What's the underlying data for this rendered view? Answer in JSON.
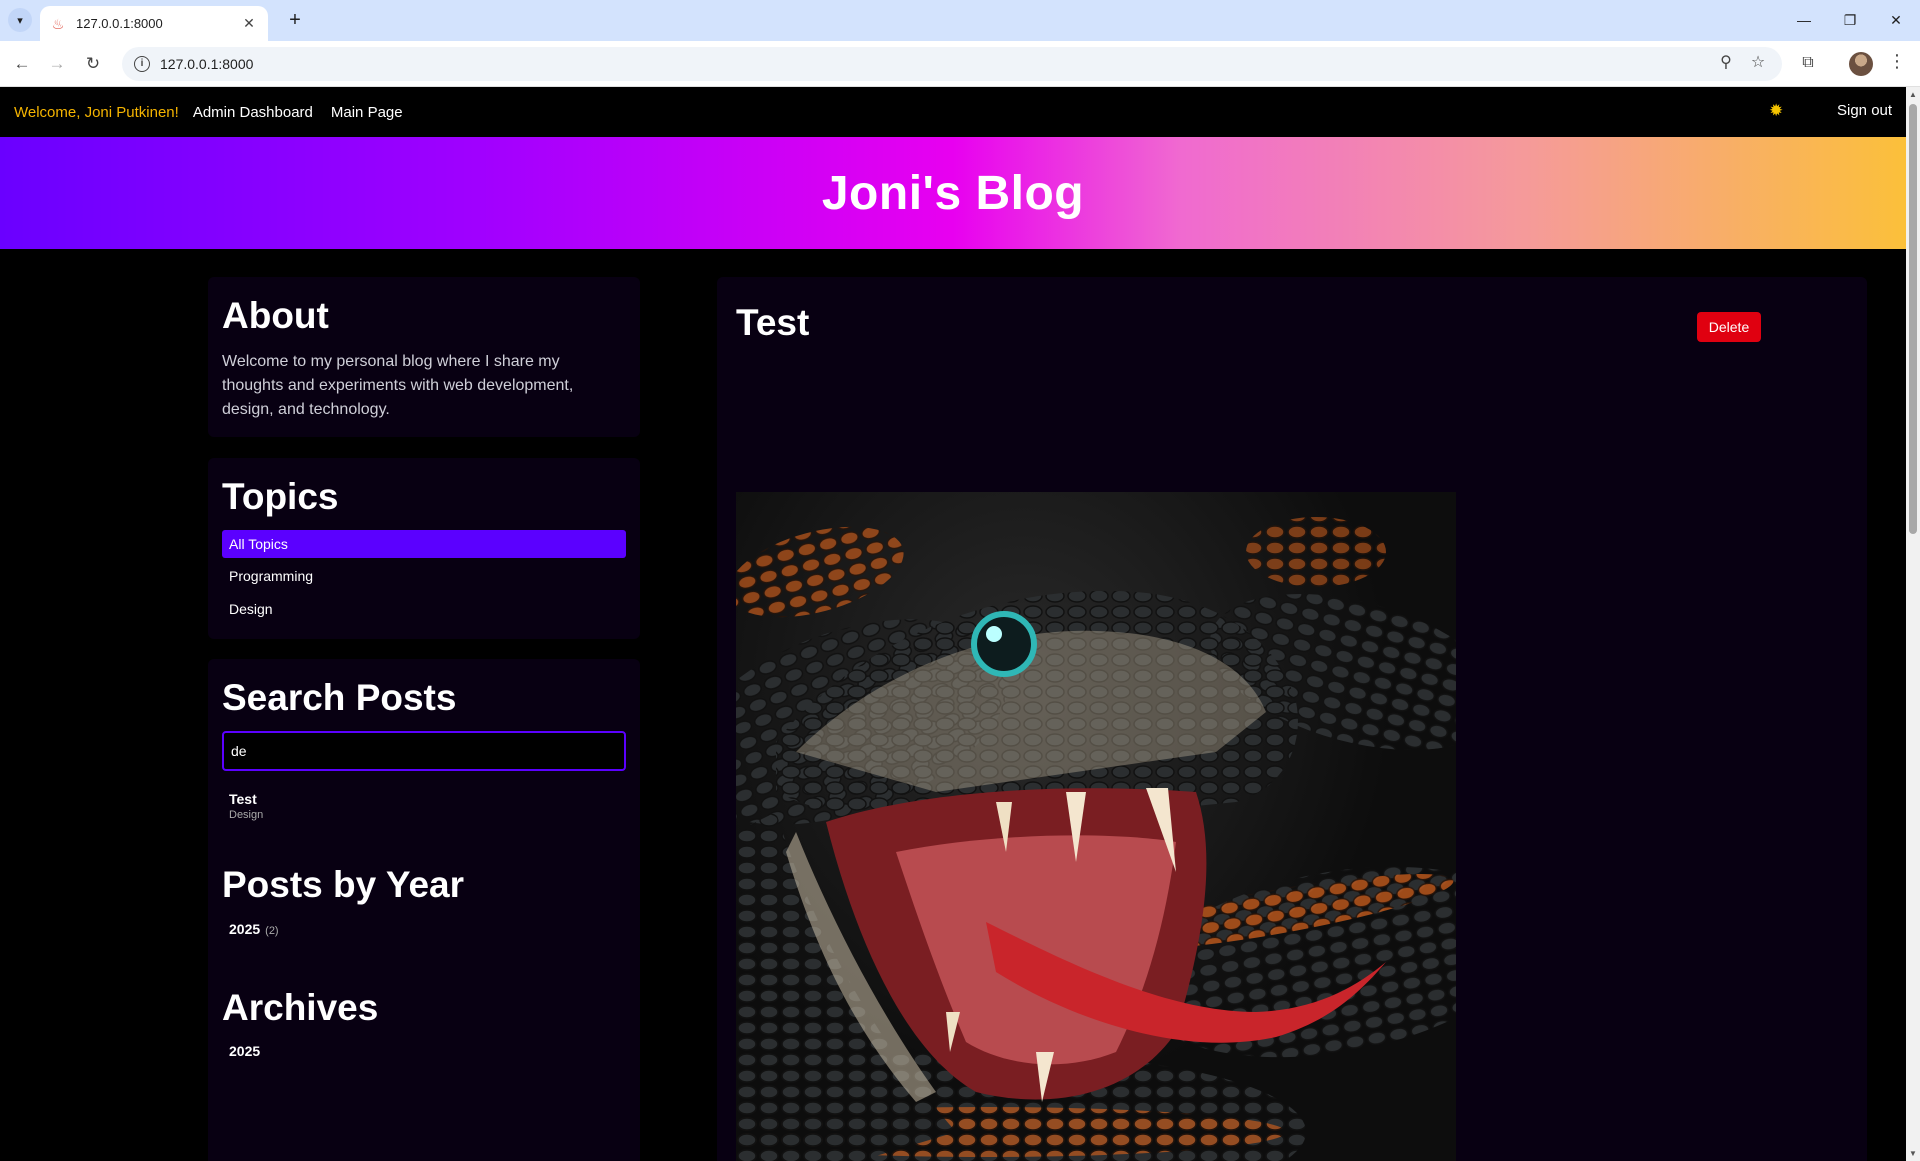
{
  "browser": {
    "tab_title": "127.0.0.1:8000",
    "url": "127.0.0.1:8000"
  },
  "nav": {
    "welcome": "Welcome, Joni Putkinen!",
    "admin_dashboard": "Admin Dashboard",
    "main_page": "Main Page",
    "sign_out": "Sign out"
  },
  "hero": {
    "title": "Joni's Blog"
  },
  "sidebar": {
    "about": {
      "heading": "About",
      "text": "Welcome to my personal blog where I share my thoughts and experiments with web development, design, and technology."
    },
    "topics": {
      "heading": "Topics",
      "items": [
        {
          "label": "All Topics",
          "active": true
        },
        {
          "label": "Programming",
          "active": false
        },
        {
          "label": "Design",
          "active": false
        }
      ]
    },
    "search": {
      "heading": "Search Posts",
      "value": "de",
      "results": [
        {
          "title": "Test",
          "topic": "Design"
        }
      ]
    },
    "posts_by_year": {
      "heading": "Posts by Year",
      "items": [
        {
          "year": "2025",
          "count": "(2)"
        }
      ]
    },
    "archives": {
      "heading": "Archives",
      "items": [
        {
          "year": "2025"
        }
      ]
    }
  },
  "post": {
    "title": "Test",
    "delete_label": "Delete",
    "image_subject": "snake-image"
  },
  "colors": {
    "accent": "#5b00ff",
    "welcome": "#f5b400",
    "delete": "#e00010",
    "card_bg": "#080012"
  }
}
